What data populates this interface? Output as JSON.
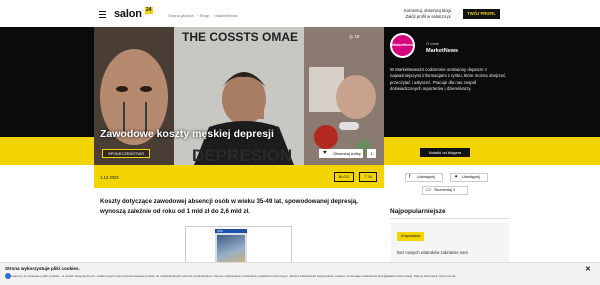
{
  "header": {
    "logo": "salon",
    "logo_badge": "24",
    "breadcrumbs": [
      "Strona główna",
      "Blogi",
      "MarketNews"
    ],
    "promo_line1": "Komentuj, obserwuj blogi.",
    "promo_line2": "Załóż profil w salon24.pl",
    "profile_button": "TWÓJ PROFIL"
  },
  "hero": {
    "title": "Zawodowe koszty męskiej depresji",
    "tag": "SPOŁECZEŃSTWO",
    "follow_label": "Obserwuj notkę",
    "follow_count": "1",
    "photo_count": "18",
    "image_text_top": "THE COSSTS OMAE",
    "image_text_bottom": "DEPRESION"
  },
  "author": {
    "avatar_text": "MarketNews",
    "role": "O mnie",
    "name": "MarketNews",
    "bio": "W MarketNews24 codziennie omówiony depesze z najważniejszymi informacjami z rynku, które można obejrzeć, przeczytać i usłyszeć. Pracuje dla nas zespół doświadczonych reporterów i dziennikarzy.",
    "more_button": "Notatki od blogera"
  },
  "meta": {
    "date": "1.12.2023",
    "blog_btn": "BLOG",
    "likes_btn": "7 2d"
  },
  "share": {
    "facebook": "Udostępnij",
    "twitter": "Udostępnij",
    "comments": "Skomentuj",
    "comments_count": "1"
  },
  "article": {
    "lead": "Koszty dotyczące zawodowej absencji osób w wieku 35-49 lat, spowodowanej depresją, wynoszą zależnie od roku od 1 mld zł do 2,6 mld zł.",
    "ad_label": "PS5"
  },
  "popular": {
    "title": "Najpopularniejsze",
    "tag": "Gospodarka",
    "text": "Bez nowych wiatraków zabraknie nam"
  },
  "cookie": {
    "title": "Strona wykorzystuje pliki cookies.",
    "text": "Informujemy, że stosujemy pliki cookies - w celach statystycznych, reklamowych oraz przystosowania serwisu do indywidualnych potrzeb użytkowników. Są one zapisywane w Państwa urządzeniu końcowym. Można zablokować zapisywanie cookies, zmieniając ustawienia przeglądarki internetowej. Więcej informacji na ten temat."
  },
  "colors": {
    "accent": "#f2d400",
    "dark": "#0b0b0b",
    "avatar": "#d6007c"
  }
}
